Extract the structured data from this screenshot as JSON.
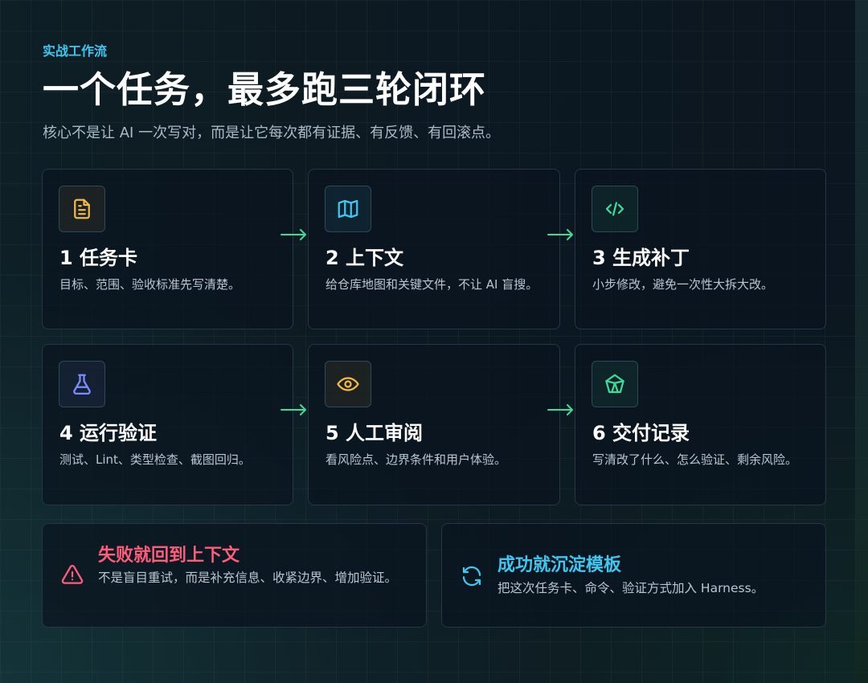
{
  "header": {
    "eyebrow": "实战工作流",
    "title": "一个任务，最多跑三轮闭环",
    "subtitle": "核心不是让 AI 一次写对，而是让它每次都有证据、有反馈、有回滚点。"
  },
  "steps": [
    {
      "title": "1 任务卡",
      "desc": "目标、范围、验收标准先写清楚。",
      "icon": "document-icon",
      "color": "#f2b84b"
    },
    {
      "title": "2 上下文",
      "desc": "给仓库地图和关键文件，不让 AI 盲搜。",
      "icon": "map-icon",
      "color": "#3ec7f0"
    },
    {
      "title": "3 生成补丁",
      "desc": "小步修改，避免一次性大拆大改。",
      "icon": "code-icon",
      "color": "#3ddc97"
    },
    {
      "title": "4 运行验证",
      "desc": "测试、Lint、类型检查、截图回归。",
      "icon": "flask-icon",
      "color": "#7b8cff"
    },
    {
      "title": "5 人工审阅",
      "desc": "看风险点、边界条件和用户体验。",
      "icon": "eye-icon",
      "color": "#f2b84b"
    },
    {
      "title": "6 交付记录",
      "desc": "写清改了什么、怎么验证、剩余风险。",
      "icon": "gem-icon",
      "color": "#3ddc97"
    }
  ],
  "outcomes": {
    "fail": {
      "title": "失败就回到上下文",
      "desc": "不是盲目重试，而是补充信息、收紧边界、增加验证。",
      "icon": "warning-icon",
      "color": "#ff5c7a"
    },
    "success": {
      "title": "成功就沉淀模板",
      "desc": "把这次任务卡、命令、验证方式加入 Harness。",
      "icon": "refresh-icon",
      "color": "#3ec7f0"
    }
  },
  "colors": {
    "arrow": "#3ddc97",
    "accent": "#3ec7f0"
  }
}
